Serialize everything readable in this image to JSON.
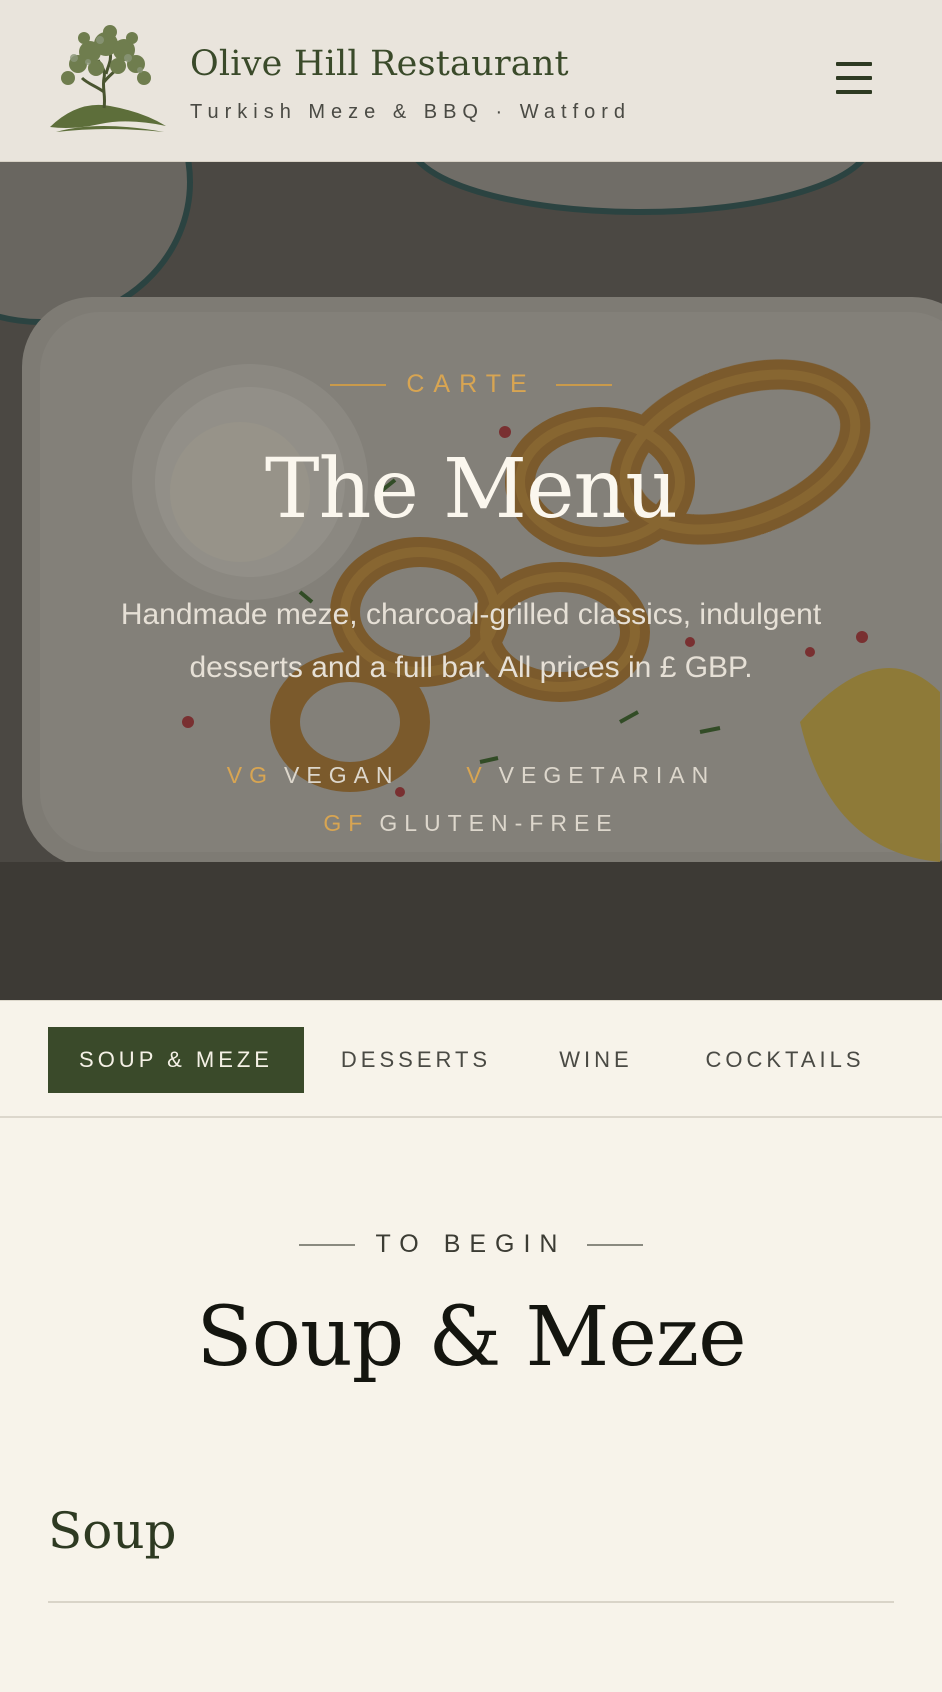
{
  "header": {
    "title": "Olive Hill Restaurant",
    "subtitle": "Turkish Meze & BBQ · Watford",
    "logo_icon": "olive-tree-logo",
    "menu_icon": "hamburger-menu-icon"
  },
  "hero": {
    "eyebrow": "CARTE",
    "title": "The Menu",
    "description": "Handmade meze, charcoal-grilled classics, indulgent desserts and a full bar. All prices in £ GBP.",
    "legend": [
      {
        "code": "VG",
        "label": "VEGAN"
      },
      {
        "code": "V",
        "label": "VEGETARIAN"
      },
      {
        "code": "GF",
        "label": "GLUTEN-FREE"
      }
    ]
  },
  "tabs": [
    {
      "label": "SOUP & MEZE",
      "active": true
    },
    {
      "label": "DESSERTS",
      "active": false
    },
    {
      "label": "WINE",
      "active": false
    },
    {
      "label": "COCKTAILS",
      "active": false
    }
  ],
  "section": {
    "eyebrow": "TO BEGIN",
    "title": "Soup & Meze",
    "subsection_title": "Soup"
  },
  "colors": {
    "brand_green": "#3a4a2a",
    "accent_gold": "#d8a552",
    "background_cream": "#f7f3ea"
  }
}
